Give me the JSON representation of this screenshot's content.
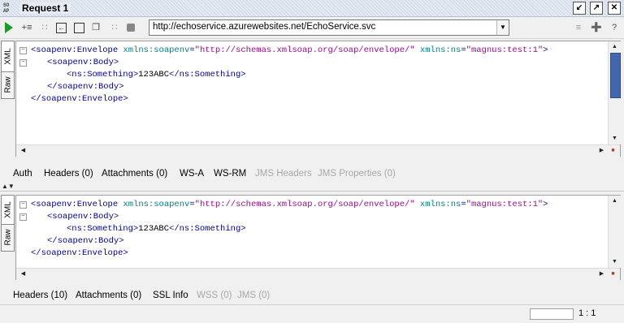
{
  "window": {
    "title": "Request 1",
    "icon": "soap-icon"
  },
  "toolbar": {
    "url": "http://echoservice.azurewebsites.net/EchoService.svc"
  },
  "editor_tabs": {
    "xml": "XML",
    "raw": "Raw"
  },
  "request": {
    "lines": [
      [
        [
          "tag",
          "<soapenv:Envelope "
        ],
        [
          "attr",
          "xmlns:soapenv"
        ],
        [
          "tag",
          "="
        ],
        [
          "val",
          "\"http://schemas.xmlsoap.org/soap/envelope/\""
        ],
        [
          "tag",
          " "
        ],
        [
          "attr",
          "xmlns:ns"
        ],
        [
          "tag",
          "="
        ],
        [
          "val",
          "\"magnus:test:1\""
        ],
        [
          "tag",
          ">"
        ]
      ],
      [
        [
          "tag",
          "<soapenv:Body>"
        ]
      ],
      [
        [
          "tag",
          "<ns:Something>"
        ],
        [
          "txt",
          "123ABC"
        ],
        [
          "tag",
          "</ns:Something>"
        ]
      ],
      [
        [
          "tag",
          "</soapenv:Body>"
        ]
      ],
      [
        [
          "tag",
          "</soapenv:Envelope>"
        ]
      ]
    ],
    "tabs": [
      {
        "label": "Auth",
        "enabled": true
      },
      {
        "label": "Headers (0)",
        "enabled": true
      },
      {
        "label": "Attachments (0)",
        "enabled": true
      },
      {
        "label": "WS-A",
        "enabled": true
      },
      {
        "label": "WS-RM",
        "enabled": true
      },
      {
        "label": "JMS Headers",
        "enabled": false
      },
      {
        "label": "JMS Properties (0)",
        "enabled": false
      }
    ]
  },
  "response": {
    "lines": [
      [
        [
          "tag",
          "<soapenv:Envelope "
        ],
        [
          "attr",
          "xmlns:soapenv"
        ],
        [
          "tag",
          "="
        ],
        [
          "val",
          "\"http://schemas.xmlsoap.org/soap/envelope/\""
        ],
        [
          "tag",
          " "
        ],
        [
          "attr",
          "xmlns:ns"
        ],
        [
          "tag",
          "="
        ],
        [
          "val",
          "\"magnus:test:1\""
        ],
        [
          "tag",
          ">"
        ]
      ],
      [
        [
          "tag",
          "<soapenv:Body>"
        ]
      ],
      [
        [
          "tag",
          "<ns:Something>"
        ],
        [
          "txt",
          "123ABC"
        ],
        [
          "tag",
          "</ns:Something>"
        ]
      ],
      [
        [
          "tag",
          "</soapenv:Body>"
        ]
      ],
      [
        [
          "tag",
          "</soapenv:Envelope>"
        ]
      ]
    ],
    "tabs": [
      {
        "label": "Headers (10)",
        "enabled": true
      },
      {
        "label": "Attachments (0)",
        "enabled": true
      },
      {
        "label": "SSL Info",
        "enabled": true
      },
      {
        "label": "WSS (0)",
        "enabled": false
      },
      {
        "label": "JMS (0)",
        "enabled": false
      }
    ]
  },
  "status": {
    "position": "1 : 1"
  }
}
